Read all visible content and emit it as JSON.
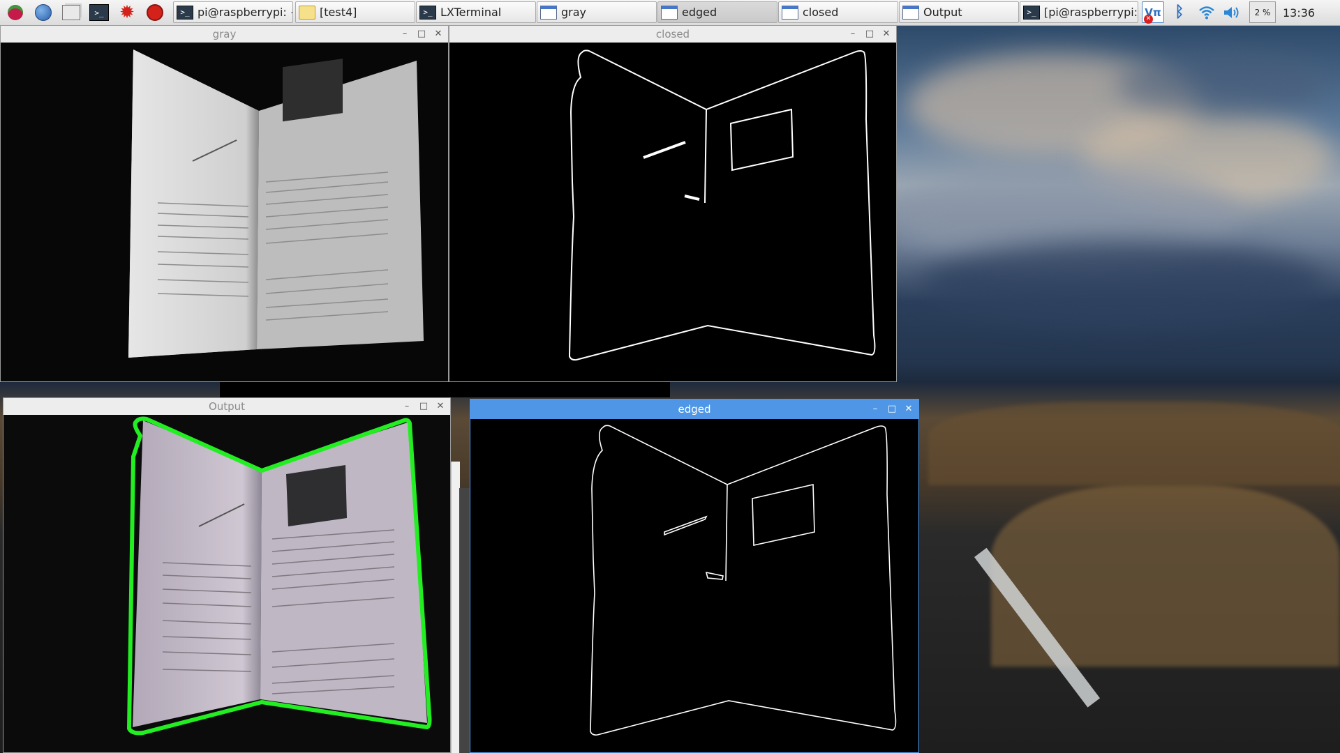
{
  "taskbar": {
    "launchers": [
      {
        "name": "raspberry-menu-icon",
        "glyph": "❦",
        "color": "#c51a4a"
      },
      {
        "name": "web-browser-icon",
        "glyph": "◍",
        "color": "#2f6fbf"
      },
      {
        "name": "file-manager-icon",
        "glyph": "▭",
        "color": "#777"
      },
      {
        "name": "terminal-icon",
        "glyph": ">_",
        "color": "#2b3a4a"
      },
      {
        "name": "mathematica-icon",
        "glyph": "✹",
        "color": "#d4221b"
      },
      {
        "name": "wolfram-icon",
        "glyph": "◉",
        "color": "#d4221b"
      }
    ],
    "tasks": [
      {
        "label": "pi@raspberrypi: ~",
        "icon": "terminal"
      },
      {
        "label": "[test4]",
        "icon": "folder"
      },
      {
        "label": "LXTerminal",
        "icon": "terminal"
      },
      {
        "label": "gray",
        "icon": "window"
      },
      {
        "label": "edged",
        "icon": "window"
      },
      {
        "label": "closed",
        "icon": "window"
      },
      {
        "label": "Output",
        "icon": "window"
      },
      {
        "label": "[pi@raspberrypi: ...",
        "icon": "terminal"
      }
    ],
    "tray": {
      "vnc_label": "Vπ",
      "cpu_label": "2 %",
      "clock": "13:36"
    }
  },
  "windows": {
    "gray": {
      "title": "gray"
    },
    "closed": {
      "title": "closed"
    },
    "output": {
      "title": "Output"
    },
    "edged": {
      "title": "edged"
    }
  },
  "controls": {
    "minimize": "–",
    "maximize": "□",
    "close": "✕"
  },
  "colors": {
    "contour": "#22ee22",
    "active_titlebar": "#4f97e6",
    "edge_line": "#ffffff"
  }
}
